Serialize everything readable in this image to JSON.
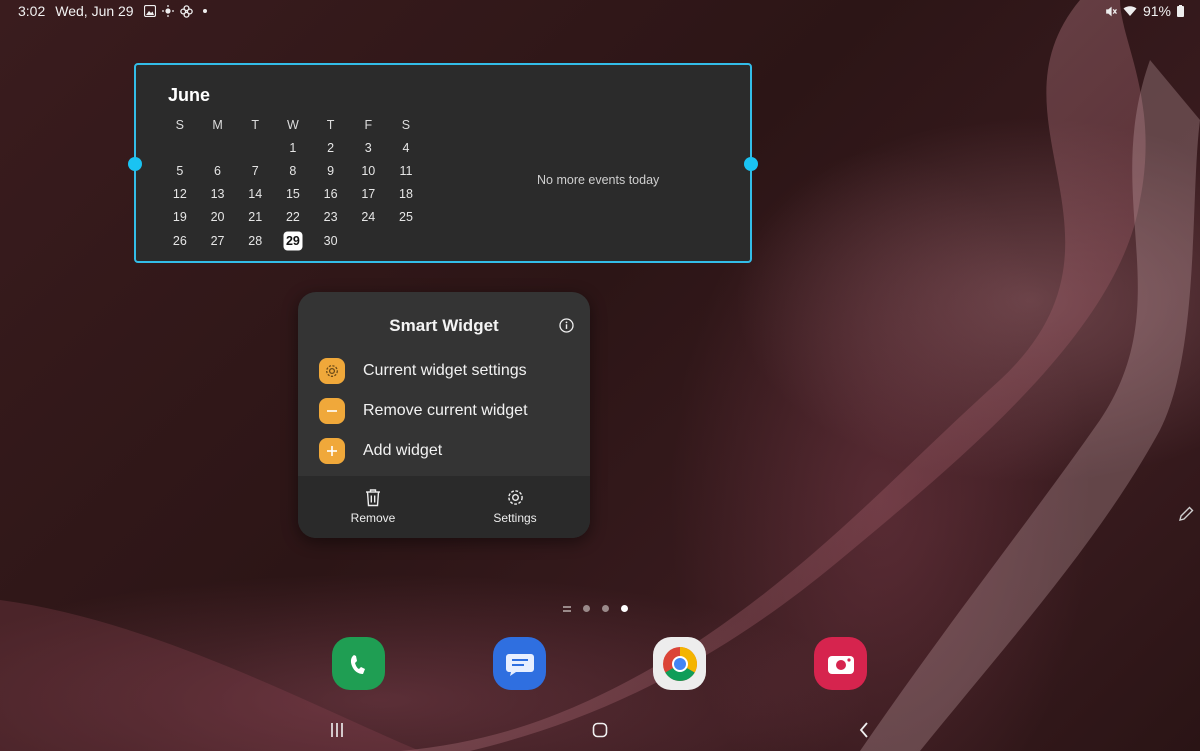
{
  "status_bar": {
    "time": "3:02",
    "date": "Wed, Jun 29",
    "battery": "91%",
    "left_icons": [
      "image-icon",
      "brightness-icon",
      "pinwheel-icon",
      "dot-icon"
    ],
    "right_icons": [
      "mute-icon",
      "wifi-icon",
      "battery-icon"
    ]
  },
  "calendar_widget": {
    "month": "June",
    "weekdays": [
      "S",
      "M",
      "T",
      "W",
      "T",
      "F",
      "S"
    ],
    "weeks": [
      [
        "",
        "",
        "",
        "1",
        "2",
        "3",
        "4"
      ],
      [
        "5",
        "6",
        "7",
        "8",
        "9",
        "10",
        "11"
      ],
      [
        "12",
        "13",
        "14",
        "15",
        "16",
        "17",
        "18"
      ],
      [
        "19",
        "20",
        "21",
        "22",
        "23",
        "24",
        "25"
      ],
      [
        "26",
        "27",
        "28",
        "29",
        "30",
        "",
        ""
      ]
    ],
    "today": "29",
    "no_events": "No more events today"
  },
  "popup": {
    "title": "Smart Widget",
    "items": [
      {
        "label": "Current widget settings",
        "icon": "gear-icon"
      },
      {
        "label": "Remove current widget",
        "icon": "minus-icon"
      },
      {
        "label": "Add widget",
        "icon": "plus-icon"
      }
    ],
    "bottom": {
      "remove_label": "Remove",
      "settings_label": "Settings"
    }
  },
  "dock": [
    {
      "name": "Phone",
      "icon": "phone-icon",
      "color": "#1f9e53"
    },
    {
      "name": "Messages",
      "icon": "messages-icon",
      "color": "#2f6fe0"
    },
    {
      "name": "Chrome",
      "icon": "chrome-icon",
      "color": "#ededed"
    },
    {
      "name": "Camera",
      "icon": "camera-icon",
      "color": "#d6244e"
    }
  ],
  "colors": {
    "selection_accent": "#33bde8",
    "menu_icon_accent": "#f0a83a"
  }
}
